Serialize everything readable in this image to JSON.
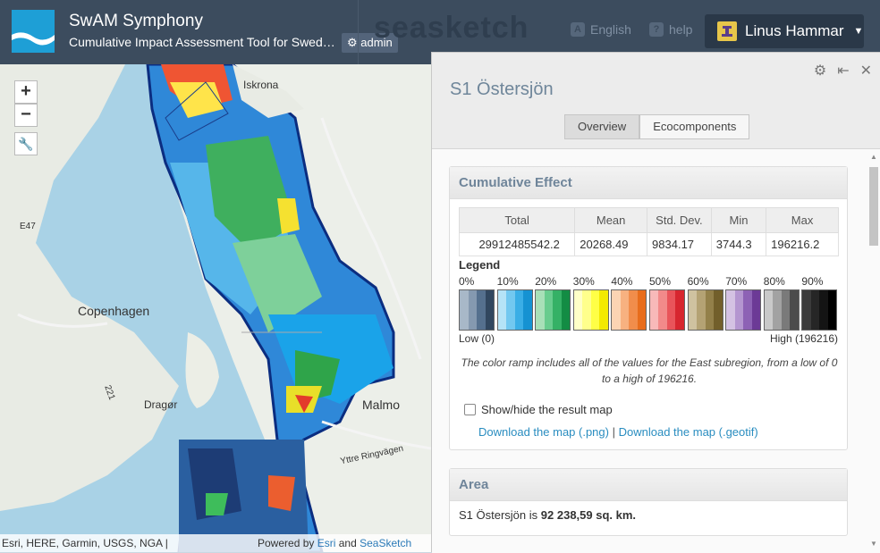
{
  "header": {
    "app_title": "SwAM Symphony",
    "app_subtitle": "Cumulative Impact Assessment Tool for Sweden'...",
    "admin_label": "admin",
    "brand": "seasketch",
    "language": "English",
    "help": "help",
    "user_name": "Linus Hammar"
  },
  "map": {
    "zoom_in": "+",
    "zoom_out": "−",
    "labels": {
      "city1": "Copenhagen",
      "city2": "Malmo",
      "town1": "Dragør",
      "town2": "Iskrona",
      "road": "Yttre Ringvägen",
      "hwy1": "E47",
      "hwy2": "221"
    },
    "attribution_left": "Esri, HERE, Garmin, USGS, NGA |",
    "attribution_powered": "Powered by",
    "attribution_esri": "Esri",
    "attribution_and": "and",
    "attribution_seasketch": "SeaSketch"
  },
  "panel": {
    "title": "S1 Östersjön",
    "tabs": [
      "Overview",
      "Ecocomponents"
    ],
    "active_tab": "Overview",
    "cumulative": {
      "heading": "Cumulative Effect",
      "columns": [
        "Total",
        "Mean",
        "Std. Dev.",
        "Min",
        "Max"
      ],
      "values": [
        "29912485542.2",
        "20268.49",
        "9834.17",
        "3744.3",
        "196216.2"
      ],
      "legend_title": "Legend",
      "percents": [
        "0%",
        "10%",
        "20%",
        "30%",
        "40%",
        "50%",
        "60%",
        "70%",
        "80%",
        "90%"
      ],
      "low_label": "Low (0)",
      "high_label": "High (196216)",
      "note": "The color ramp includes all of the values for the East subregion, from a low of 0 to a high of 196216.",
      "toggle_label": "Show/hide the result map",
      "download_png": "Download the map (.png)",
      "separator": "|",
      "download_geotif": "Download the map (.geotif)"
    },
    "area": {
      "heading": "Area",
      "text_prefix": "S1 Östersjön is",
      "value": "92 238,59 sq. km."
    }
  },
  "colors": {
    "header_bg": "#3c4c5e",
    "accent_link": "#2a8dc0",
    "ramp": [
      [
        "#a8b8c8",
        "#8599b0",
        "#55708e",
        "#31475f"
      ],
      [
        "#b5e3f7",
        "#72c8f0",
        "#3aaee6",
        "#1592d2"
      ],
      [
        "#a8e0b8",
        "#68cc8e",
        "#35b166",
        "#138c44"
      ],
      [
        "#ffffc8",
        "#ffff8c",
        "#ffff46",
        "#f3ea00"
      ],
      [
        "#fbd4b3",
        "#f7b180",
        "#f18d4b",
        "#e86d1c"
      ],
      [
        "#f8b9b9",
        "#f28a8a",
        "#e9545a",
        "#d7262f"
      ],
      [
        "#cfc2a0",
        "#b4a274",
        "#93804a",
        "#725f2b"
      ],
      [
        "#d4c2e3",
        "#b496d0",
        "#8d62b5",
        "#6c3a96"
      ],
      [
        "#c9c9c9",
        "#a2a2a2",
        "#7a7a7a",
        "#4c4c4c"
      ],
      [
        "#3b3b3b",
        "#262626",
        "#141414",
        "#000000"
      ]
    ]
  }
}
